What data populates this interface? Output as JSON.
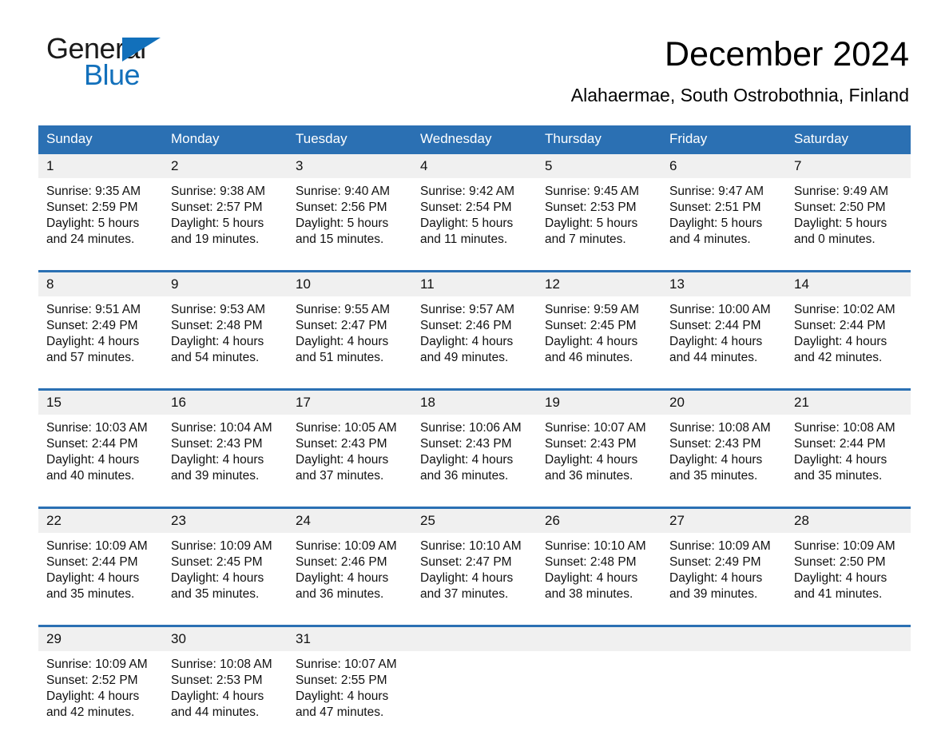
{
  "brand": {
    "name_part1": "General",
    "name_part2": "Blue",
    "logo_icon": "triangle-icon",
    "accent_color": "#1270bb"
  },
  "header": {
    "month_title": "December 2024",
    "location": "Alahaermae, South Ostrobothnia, Finland"
  },
  "calendar": {
    "header_bg": "#2b70b3",
    "daynum_bg": "#f0f0f0",
    "weekdays": [
      "Sunday",
      "Monday",
      "Tuesday",
      "Wednesday",
      "Thursday",
      "Friday",
      "Saturday"
    ],
    "weeks": [
      {
        "days": [
          {
            "num": "1",
            "sunrise": "Sunrise: 9:35 AM",
            "sunset": "Sunset: 2:59 PM",
            "daylight1": "Daylight: 5 hours",
            "daylight2": "and 24 minutes."
          },
          {
            "num": "2",
            "sunrise": "Sunrise: 9:38 AM",
            "sunset": "Sunset: 2:57 PM",
            "daylight1": "Daylight: 5 hours",
            "daylight2": "and 19 minutes."
          },
          {
            "num": "3",
            "sunrise": "Sunrise: 9:40 AM",
            "sunset": "Sunset: 2:56 PM",
            "daylight1": "Daylight: 5 hours",
            "daylight2": "and 15 minutes."
          },
          {
            "num": "4",
            "sunrise": "Sunrise: 9:42 AM",
            "sunset": "Sunset: 2:54 PM",
            "daylight1": "Daylight: 5 hours",
            "daylight2": "and 11 minutes."
          },
          {
            "num": "5",
            "sunrise": "Sunrise: 9:45 AM",
            "sunset": "Sunset: 2:53 PM",
            "daylight1": "Daylight: 5 hours",
            "daylight2": "and 7 minutes."
          },
          {
            "num": "6",
            "sunrise": "Sunrise: 9:47 AM",
            "sunset": "Sunset: 2:51 PM",
            "daylight1": "Daylight: 5 hours",
            "daylight2": "and 4 minutes."
          },
          {
            "num": "7",
            "sunrise": "Sunrise: 9:49 AM",
            "sunset": "Sunset: 2:50 PM",
            "daylight1": "Daylight: 5 hours",
            "daylight2": "and 0 minutes."
          }
        ]
      },
      {
        "days": [
          {
            "num": "8",
            "sunrise": "Sunrise: 9:51 AM",
            "sunset": "Sunset: 2:49 PM",
            "daylight1": "Daylight: 4 hours",
            "daylight2": "and 57 minutes."
          },
          {
            "num": "9",
            "sunrise": "Sunrise: 9:53 AM",
            "sunset": "Sunset: 2:48 PM",
            "daylight1": "Daylight: 4 hours",
            "daylight2": "and 54 minutes."
          },
          {
            "num": "10",
            "sunrise": "Sunrise: 9:55 AM",
            "sunset": "Sunset: 2:47 PM",
            "daylight1": "Daylight: 4 hours",
            "daylight2": "and 51 minutes."
          },
          {
            "num": "11",
            "sunrise": "Sunrise: 9:57 AM",
            "sunset": "Sunset: 2:46 PM",
            "daylight1": "Daylight: 4 hours",
            "daylight2": "and 49 minutes."
          },
          {
            "num": "12",
            "sunrise": "Sunrise: 9:59 AM",
            "sunset": "Sunset: 2:45 PM",
            "daylight1": "Daylight: 4 hours",
            "daylight2": "and 46 minutes."
          },
          {
            "num": "13",
            "sunrise": "Sunrise: 10:00 AM",
            "sunset": "Sunset: 2:44 PM",
            "daylight1": "Daylight: 4 hours",
            "daylight2": "and 44 minutes."
          },
          {
            "num": "14",
            "sunrise": "Sunrise: 10:02 AM",
            "sunset": "Sunset: 2:44 PM",
            "daylight1": "Daylight: 4 hours",
            "daylight2": "and 42 minutes."
          }
        ]
      },
      {
        "days": [
          {
            "num": "15",
            "sunrise": "Sunrise: 10:03 AM",
            "sunset": "Sunset: 2:44 PM",
            "daylight1": "Daylight: 4 hours",
            "daylight2": "and 40 minutes."
          },
          {
            "num": "16",
            "sunrise": "Sunrise: 10:04 AM",
            "sunset": "Sunset: 2:43 PM",
            "daylight1": "Daylight: 4 hours",
            "daylight2": "and 39 minutes."
          },
          {
            "num": "17",
            "sunrise": "Sunrise: 10:05 AM",
            "sunset": "Sunset: 2:43 PM",
            "daylight1": "Daylight: 4 hours",
            "daylight2": "and 37 minutes."
          },
          {
            "num": "18",
            "sunrise": "Sunrise: 10:06 AM",
            "sunset": "Sunset: 2:43 PM",
            "daylight1": "Daylight: 4 hours",
            "daylight2": "and 36 minutes."
          },
          {
            "num": "19",
            "sunrise": "Sunrise: 10:07 AM",
            "sunset": "Sunset: 2:43 PM",
            "daylight1": "Daylight: 4 hours",
            "daylight2": "and 36 minutes."
          },
          {
            "num": "20",
            "sunrise": "Sunrise: 10:08 AM",
            "sunset": "Sunset: 2:43 PM",
            "daylight1": "Daylight: 4 hours",
            "daylight2": "and 35 minutes."
          },
          {
            "num": "21",
            "sunrise": "Sunrise: 10:08 AM",
            "sunset": "Sunset: 2:44 PM",
            "daylight1": "Daylight: 4 hours",
            "daylight2": "and 35 minutes."
          }
        ]
      },
      {
        "days": [
          {
            "num": "22",
            "sunrise": "Sunrise: 10:09 AM",
            "sunset": "Sunset: 2:44 PM",
            "daylight1": "Daylight: 4 hours",
            "daylight2": "and 35 minutes."
          },
          {
            "num": "23",
            "sunrise": "Sunrise: 10:09 AM",
            "sunset": "Sunset: 2:45 PM",
            "daylight1": "Daylight: 4 hours",
            "daylight2": "and 35 minutes."
          },
          {
            "num": "24",
            "sunrise": "Sunrise: 10:09 AM",
            "sunset": "Sunset: 2:46 PM",
            "daylight1": "Daylight: 4 hours",
            "daylight2": "and 36 minutes."
          },
          {
            "num": "25",
            "sunrise": "Sunrise: 10:10 AM",
            "sunset": "Sunset: 2:47 PM",
            "daylight1": "Daylight: 4 hours",
            "daylight2": "and 37 minutes."
          },
          {
            "num": "26",
            "sunrise": "Sunrise: 10:10 AM",
            "sunset": "Sunset: 2:48 PM",
            "daylight1": "Daylight: 4 hours",
            "daylight2": "and 38 minutes."
          },
          {
            "num": "27",
            "sunrise": "Sunrise: 10:09 AM",
            "sunset": "Sunset: 2:49 PM",
            "daylight1": "Daylight: 4 hours",
            "daylight2": "and 39 minutes."
          },
          {
            "num": "28",
            "sunrise": "Sunrise: 10:09 AM",
            "sunset": "Sunset: 2:50 PM",
            "daylight1": "Daylight: 4 hours",
            "daylight2": "and 41 minutes."
          }
        ]
      },
      {
        "days": [
          {
            "num": "29",
            "sunrise": "Sunrise: 10:09 AM",
            "sunset": "Sunset: 2:52 PM",
            "daylight1": "Daylight: 4 hours",
            "daylight2": "and 42 minutes."
          },
          {
            "num": "30",
            "sunrise": "Sunrise: 10:08 AM",
            "sunset": "Sunset: 2:53 PM",
            "daylight1": "Daylight: 4 hours",
            "daylight2": "and 44 minutes."
          },
          {
            "num": "31",
            "sunrise": "Sunrise: 10:07 AM",
            "sunset": "Sunset: 2:55 PM",
            "daylight1": "Daylight: 4 hours",
            "daylight2": "and 47 minutes."
          },
          {
            "num": "",
            "sunrise": "",
            "sunset": "",
            "daylight1": "",
            "daylight2": ""
          },
          {
            "num": "",
            "sunrise": "",
            "sunset": "",
            "daylight1": "",
            "daylight2": ""
          },
          {
            "num": "",
            "sunrise": "",
            "sunset": "",
            "daylight1": "",
            "daylight2": ""
          },
          {
            "num": "",
            "sunrise": "",
            "sunset": "",
            "daylight1": "",
            "daylight2": ""
          }
        ]
      }
    ]
  }
}
